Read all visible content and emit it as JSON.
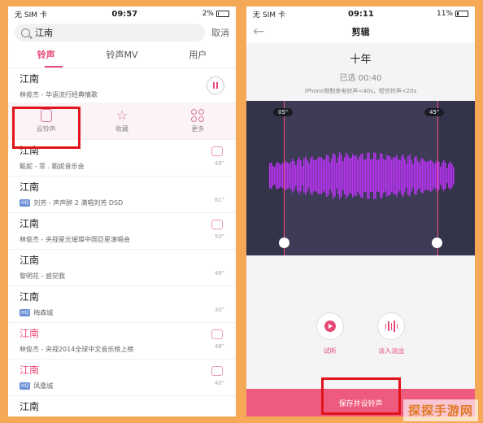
{
  "left": {
    "status": {
      "carrier": "无 SIM 卡",
      "time": "09:57",
      "battery": "2%"
    },
    "search": {
      "query": "江南",
      "cancel": "取消"
    },
    "tabs": [
      "铃声",
      "铃声MV",
      "用户"
    ],
    "playing": {
      "title": "江南",
      "subtitle": "林俊杰 - 华语流行经典情歌"
    },
    "actions": {
      "set_ringtone": "设铃声",
      "favorite": "收藏",
      "more": "更多"
    },
    "songs": [
      {
        "title": "江南",
        "subtitle": "甄妮 - 菲 . 甄妮音乐会",
        "duration": "48\"",
        "hq": false,
        "red": false
      },
      {
        "title": "江南",
        "subtitle": "刘芳 - 声声醉 2 满唱刘芳 DSD",
        "duration": "61\"",
        "hq": true,
        "red": false
      },
      {
        "title": "江南",
        "subtitle": "林俊杰 - 央视星光璀璨中国巨星演唱会",
        "duration": "50\"",
        "hq": false,
        "red": false
      },
      {
        "title": "江南",
        "subtitle": "黎明花 - 感觉我",
        "duration": "48\"",
        "hq": false,
        "red": false
      },
      {
        "title": "江南",
        "subtitle": "梅森城",
        "duration": "30\"",
        "hq": true,
        "red": false
      },
      {
        "title": "江南",
        "subtitle": "林俊杰 - 央视2014全球中文音乐榜上榜",
        "duration": "48\"",
        "hq": false,
        "red": true
      },
      {
        "title": "江南",
        "subtitle": "凤凰城",
        "duration": "40\"",
        "hq": true,
        "red": true
      },
      {
        "title": "江南",
        "subtitle": "",
        "duration": "",
        "hq": false,
        "red": false
      }
    ]
  },
  "right": {
    "status": {
      "carrier": "无 SIM 卡",
      "time": "09:11",
      "battery": "11%"
    },
    "nav_title": "剪辑",
    "song_title": "十年",
    "selected": "已选 00:40",
    "hint": "iPhone限制来电铃声<40s，短信铃声<20s",
    "start_marker": "05\"",
    "end_marker": "45\"",
    "controls": {
      "preview": "试听",
      "fade": "淡入淡出"
    },
    "save_label": "保存并设铃声"
  },
  "watermark": "探探手游网",
  "colors": {
    "accent": "#e84a76",
    "highlight_box": "#e2141b",
    "wave": "#b533ee"
  }
}
